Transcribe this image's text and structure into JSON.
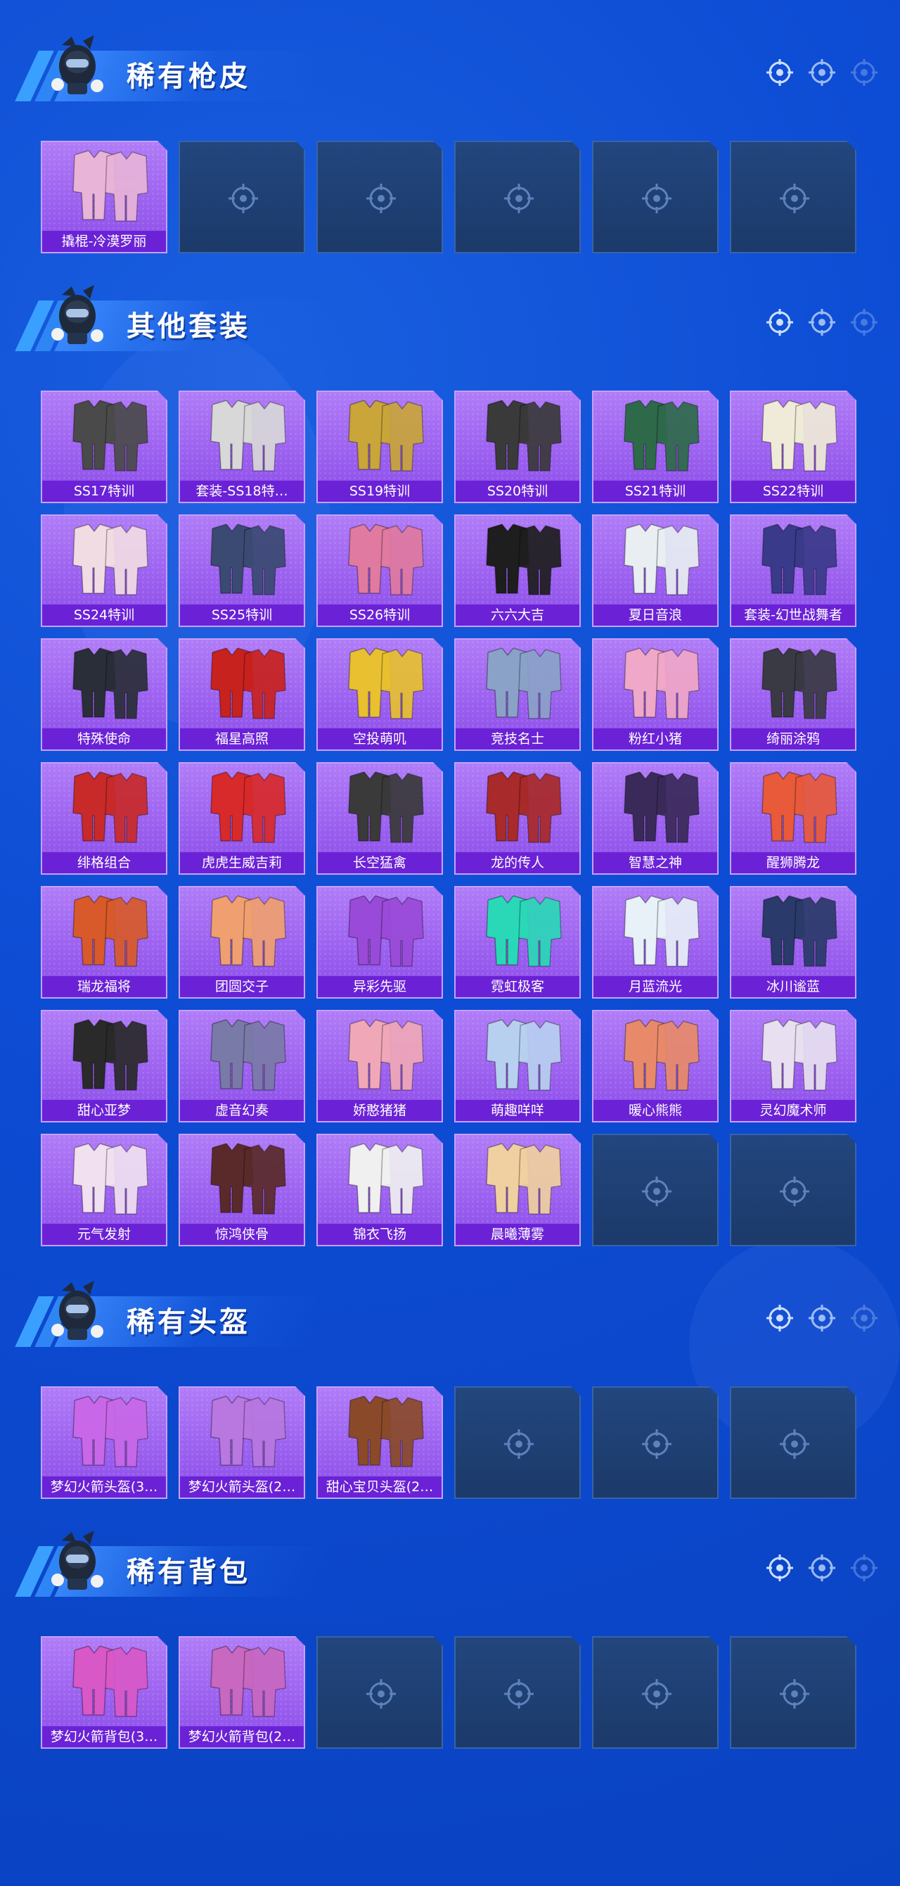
{
  "sections": [
    {
      "title": "稀有枪皮",
      "items": [
        {
          "label": "撬棍-冷漠罗丽",
          "color": "#e8b4d8"
        },
        {
          "label": ""
        },
        {
          "label": ""
        },
        {
          "label": ""
        },
        {
          "label": ""
        },
        {
          "label": ""
        }
      ]
    },
    {
      "title": "其他套装",
      "items": [
        {
          "label": "SS17特训",
          "color": "#4a4a4a"
        },
        {
          "label": "套装-SS18特…",
          "color": "#d8d8d8"
        },
        {
          "label": "SS19特训",
          "color": "#c9a53a"
        },
        {
          "label": "SS20特训",
          "color": "#3a3a3a"
        },
        {
          "label": "SS21特训",
          "color": "#2e6a4a"
        },
        {
          "label": "SS22特训",
          "color": "#f0ebd8"
        },
        {
          "label": "SS24特训",
          "color": "#f2dce4"
        },
        {
          "label": "SS25特训",
          "color": "#3a4a72"
        },
        {
          "label": "SS26特训",
          "color": "#e07aa0"
        },
        {
          "label": "六六大吉",
          "color": "#1e1e1e"
        },
        {
          "label": "夏日音浪",
          "color": "#e8eef2"
        },
        {
          "label": "套装-幻世战舞者",
          "color": "#3a3a8a"
        },
        {
          "label": "特殊使命",
          "color": "#2a2e38"
        },
        {
          "label": "福星高照",
          "color": "#c8221e"
        },
        {
          "label": "空投萌叽",
          "color": "#e8c030"
        },
        {
          "label": "竞技名士",
          "color": "#8aa2c8"
        },
        {
          "label": "粉红小猪",
          "color": "#f0a8c8"
        },
        {
          "label": "绮丽涂鸦",
          "color": "#3a3a44"
        },
        {
          "label": "绯格组合",
          "color": "#c82a2a"
        },
        {
          "label": "虎虎生威吉莉",
          "color": "#d82a2a"
        },
        {
          "label": "长空猛禽",
          "color": "#3a3a3a"
        },
        {
          "label": "龙的传人",
          "color": "#a82a2a"
        },
        {
          "label": "智慧之神",
          "color": "#3a2a5a"
        },
        {
          "label": "醒狮腾龙",
          "color": "#e85a3a"
        },
        {
          "label": "瑞龙福将",
          "color": "#d85a2a"
        },
        {
          "label": "团圆交子",
          "color": "#f0a070"
        },
        {
          "label": "异彩先驱",
          "color": "#9a4ad8"
        },
        {
          "label": "霓虹极客",
          "color": "#2ad8b8"
        },
        {
          "label": "月蓝流光",
          "color": "#e8f0f8"
        },
        {
          "label": "冰川谧蓝",
          "color": "#2a3a6a"
        },
        {
          "label": "甜心亚梦",
          "color": "#2a2a2a"
        },
        {
          "label": "虚音幻奏",
          "color": "#7a7aa8"
        },
        {
          "label": "娇憨猪猪",
          "color": "#f0a8b8"
        },
        {
          "label": "萌趣咩咩",
          "color": "#b8d0f0"
        },
        {
          "label": "暖心熊熊",
          "color": "#e88a6a"
        },
        {
          "label": "灵幻魔术师",
          "color": "#e8e0f0"
        },
        {
          "label": "元气发射",
          "color": "#f0e0f0"
        },
        {
          "label": "惊鸿侠骨",
          "color": "#5a2a2a"
        },
        {
          "label": "锦衣飞扬",
          "color": "#f0f0f0"
        },
        {
          "label": "晨曦薄雾",
          "color": "#f0d0a0"
        },
        {
          "label": ""
        },
        {
          "label": ""
        }
      ]
    },
    {
      "title": "稀有头盔",
      "items": [
        {
          "label": "梦幻火箭头盔(3…",
          "color": "#c868e8"
        },
        {
          "label": "梦幻火箭头盔(2…",
          "color": "#b878e0"
        },
        {
          "label": "甜心宝贝头盔(2…",
          "color": "#8a4a2a"
        },
        {
          "label": ""
        },
        {
          "label": ""
        },
        {
          "label": ""
        }
      ]
    },
    {
      "title": "稀有背包",
      "items": [
        {
          "label": "梦幻火箭背包(3…",
          "color": "#d858c8"
        },
        {
          "label": "梦幻火箭背包(2…",
          "color": "#c868c0"
        },
        {
          "label": ""
        },
        {
          "label": ""
        },
        {
          "label": ""
        },
        {
          "label": ""
        }
      ]
    }
  ],
  "icons": {
    "mascot": "mascot-icon",
    "target": "target-crosshair-icon",
    "placeholder": "placeholder-crosshair-icon"
  }
}
